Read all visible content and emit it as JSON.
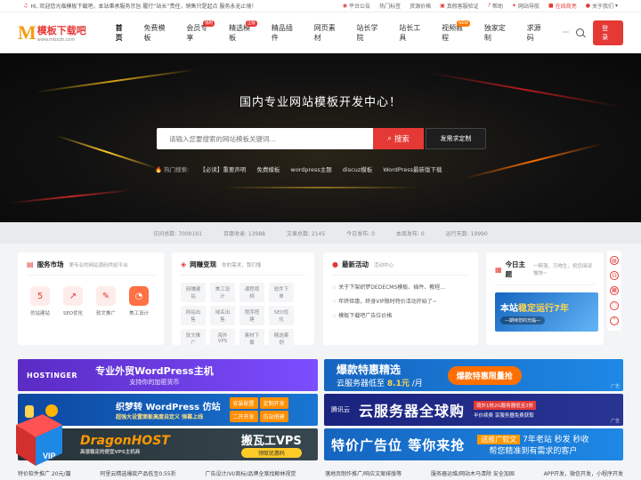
{
  "topbar": {
    "notice": "Hi, 欢迎您光临模板下载吧，本站秉承服务宗旨 履行“站长”责任，销售只是起点 服务永无止境！",
    "links": [
      "平台公告",
      "热门标签",
      "资源价格",
      "真假客服验证",
      "帮助",
      "网站导航"
    ],
    "online": "在线商亮",
    "about": "关于我们"
  },
  "logo": {
    "mark": "M",
    "name": "模板下载吧",
    "domain": "www.mbxzb.com"
  },
  "nav": {
    "items": [
      {
        "label": "首页",
        "active": true,
        "badge": ""
      },
      {
        "label": "免费模板",
        "badge": ""
      },
      {
        "label": "会员专享",
        "badge": "福利"
      },
      {
        "label": "精选模板",
        "badge": "正版"
      },
      {
        "label": "精品插件",
        "badge": ""
      },
      {
        "label": "网页素材",
        "badge": ""
      },
      {
        "label": "站长学院",
        "badge": ""
      },
      {
        "label": "站长工具",
        "badge": ""
      },
      {
        "label": "视频教程",
        "badge": "NEW"
      },
      {
        "label": "独家定制",
        "badge": ""
      },
      {
        "label": "求源码",
        "badge": ""
      },
      {
        "label": "···",
        "badge": ""
      }
    ],
    "login": "登录"
  },
  "hero": {
    "title": "国内专业网站模板开发中心！",
    "search_placeholder": "请输入您要搜索的网站模板关键词...",
    "search_button": "搜索",
    "request_button": "发需求定制",
    "hot_label": "热门搜索:",
    "hot_terms": [
      "【必读】重要声明",
      "免费模板",
      "wordpress主题",
      "discuz模板",
      "WordPress最新版下载"
    ]
  },
  "stats": [
    "访问总数: 7000191",
    "百度收录: 13988",
    "文章总数: 2145",
    "今日发布: 0",
    "本周发布: 0",
    "运行天数: 19990"
  ],
  "cards": {
    "service": {
      "title": "服务市场",
      "sub": "更专业的网站源码供给平台",
      "items": [
        {
          "label": "仿站建站",
          "glyph": "5",
          "bg": "#fdecea",
          "fg": "#e53935"
        },
        {
          "label": "SEO优化",
          "glyph": "↗",
          "bg": "#fdecea",
          "fg": "#e53935"
        },
        {
          "label": "软文推广",
          "glyph": "✎",
          "bg": "#fdecea",
          "fg": "#e53935"
        },
        {
          "label": "美工设计",
          "glyph": "◔",
          "bg": "#ff7043",
          "fg": "#fff"
        }
      ]
    },
    "earn": {
      "title": "网赚变现",
      "sub": "你的需求，我们懂",
      "tags": [
        "网赚建站",
        "美工设计",
        "课程视频",
        "软件下单",
        "网站出售",
        "域名出售",
        "程序搭建",
        "SEO优化",
        "软文推广",
        "海外VPS",
        "素材下载",
        "精选案例"
      ]
    },
    "events": {
      "title": "最新活动",
      "sub": "活动中心",
      "items": [
        "关于下架织梦DEDECMS模板、插件、教程...",
        "年终钜惠，终身VIP限时特价活动开始了~",
        "模板下载吧广告位价格"
      ]
    },
    "topic": {
      "title": "今日主题",
      "sub": "一醉落，万物生，祝您阅读愉快~",
      "banner_a": "本站",
      "banner_b": "稳定运行7年",
      "banner_sub": "—期待您的光临—"
    }
  },
  "ads": {
    "ad1": {
      "brand": "HOSTINGER",
      "title": "专业外贸WordPress主机",
      "sub": "支持你的加密货币"
    },
    "ad2": {
      "title": "爆款特惠精选",
      "sub_a": "云服务器低至",
      "sub_b": "8.1元",
      "sub_c": "/月",
      "pill": "爆款特惠限量抢",
      "tag": "广告"
    },
    "ad3": {
      "title": "织梦转 WordPress 仿站",
      "sub": "超强大设置面板高度自定义 弹幕上线",
      "btns": [
        "安装配置",
        "定制开发",
        "二开开发",
        "仿站搭建"
      ]
    },
    "ad4": {
      "brand": "腾讯云",
      "title": "云服务器全球购",
      "s1": "境外1核2G服务器低至2折",
      "s2": "半价续费 享服务器免费获取",
      "tag": "广告"
    },
    "ad5": {
      "brand": "DragonHOST",
      "sub": "高速稳定的便宜VPS主机商",
      "title": "搬瓦工VPS",
      "btn": "领取优惠码"
    },
    "ad6": {
      "title": "特价广告位 等你来抢",
      "pill": "送推广软文",
      "r1": "7年老站 秒发 秒收",
      "r2": "帮您精准到有需求的客户"
    }
  },
  "footer_links": [
    "特价软件推广 20元/篇",
    "阿里云精选爆款产品低至0.55折",
    "广告设计/VI/商标/品牌全案找鲸林视觉",
    "落地页制作推广/响应文案排版等",
    "服务器运维/网站木马清除 安全加固",
    "APP开发，微信开发，小程序开发"
  ]
}
